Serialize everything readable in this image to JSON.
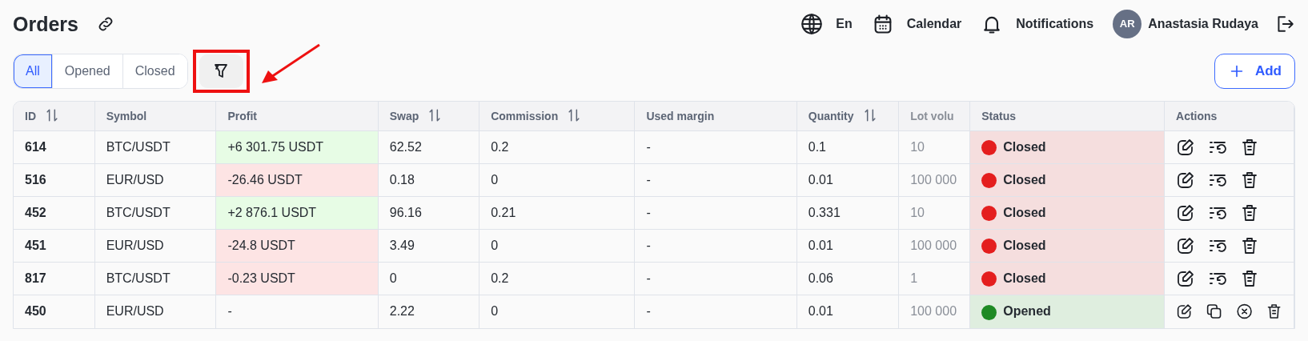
{
  "page": {
    "title": "Orders"
  },
  "header": {
    "language": "En",
    "calendar": "Calendar",
    "notifications": "Notifications",
    "user": {
      "initials": "AR",
      "name": "Anastasia Rudaya"
    }
  },
  "tabs": [
    {
      "label": "All",
      "selected": true
    },
    {
      "label": "Opened",
      "selected": false
    },
    {
      "label": "Closed",
      "selected": false
    }
  ],
  "filter_button": {
    "highlighted": true
  },
  "add_button": {
    "label": "Add"
  },
  "table": {
    "columns": [
      {
        "label": "ID",
        "sortable": true
      },
      {
        "label": "Symbol",
        "sortable": false
      },
      {
        "label": "Profit",
        "sortable": false
      },
      {
        "label": "Swap",
        "sortable": true
      },
      {
        "label": "Commission",
        "sortable": true
      },
      {
        "label": "Used margin",
        "sortable": false
      },
      {
        "label": "Quantity",
        "sortable": true
      },
      {
        "label": "Lot volu",
        "sortable": false
      },
      {
        "label": "Status",
        "sortable": false
      },
      {
        "label": "Actions",
        "sortable": false
      }
    ],
    "rows": [
      {
        "id": "614",
        "symbol": "BTC/USDT",
        "profit": {
          "text": "+6 301.75 USDT",
          "kind": "gain"
        },
        "swap": "62.52",
        "commission": "0.2",
        "used_margin": "-",
        "quantity": "0.1",
        "lot_volume": "10",
        "status": {
          "label": "Closed",
          "kind": "closed",
          "color": "#e41e1e"
        }
      },
      {
        "id": "516",
        "symbol": "EUR/USD",
        "profit": {
          "text": "-26.46 USDT",
          "kind": "loss"
        },
        "swap": "0.18",
        "commission": "0",
        "used_margin": "-",
        "quantity": "0.01",
        "lot_volume": "100 000",
        "status": {
          "label": "Closed",
          "kind": "closed",
          "color": "#e41e1e"
        }
      },
      {
        "id": "452",
        "symbol": "BTC/USDT",
        "profit": {
          "text": "+2 876.1 USDT",
          "kind": "gain"
        },
        "swap": "96.16",
        "commission": "0.21",
        "used_margin": "-",
        "quantity": "0.331",
        "lot_volume": "10",
        "status": {
          "label": "Closed",
          "kind": "closed",
          "color": "#e41e1e"
        }
      },
      {
        "id": "451",
        "symbol": "EUR/USD",
        "profit": {
          "text": "-24.8 USDT",
          "kind": "loss"
        },
        "swap": "3.49",
        "commission": "0",
        "used_margin": "-",
        "quantity": "0.01",
        "lot_volume": "100 000",
        "status": {
          "label": "Closed",
          "kind": "closed",
          "color": "#e41e1e"
        }
      },
      {
        "id": "817",
        "symbol": "BTC/USDT",
        "profit": {
          "text": "-0.23 USDT",
          "kind": "loss"
        },
        "swap": "0",
        "commission": "0.2",
        "used_margin": "-",
        "quantity": "0.06",
        "lot_volume": "1",
        "status": {
          "label": "Closed",
          "kind": "closed",
          "color": "#e41e1e"
        }
      },
      {
        "id": "450",
        "symbol": "EUR/USD",
        "profit": {
          "text": "-",
          "kind": "none"
        },
        "swap": "2.22",
        "commission": "0",
        "used_margin": "-",
        "quantity": "0.01",
        "lot_volume": "100 000",
        "status": {
          "label": "Opened",
          "kind": "opened",
          "color": "#1e8a24"
        }
      }
    ]
  }
}
